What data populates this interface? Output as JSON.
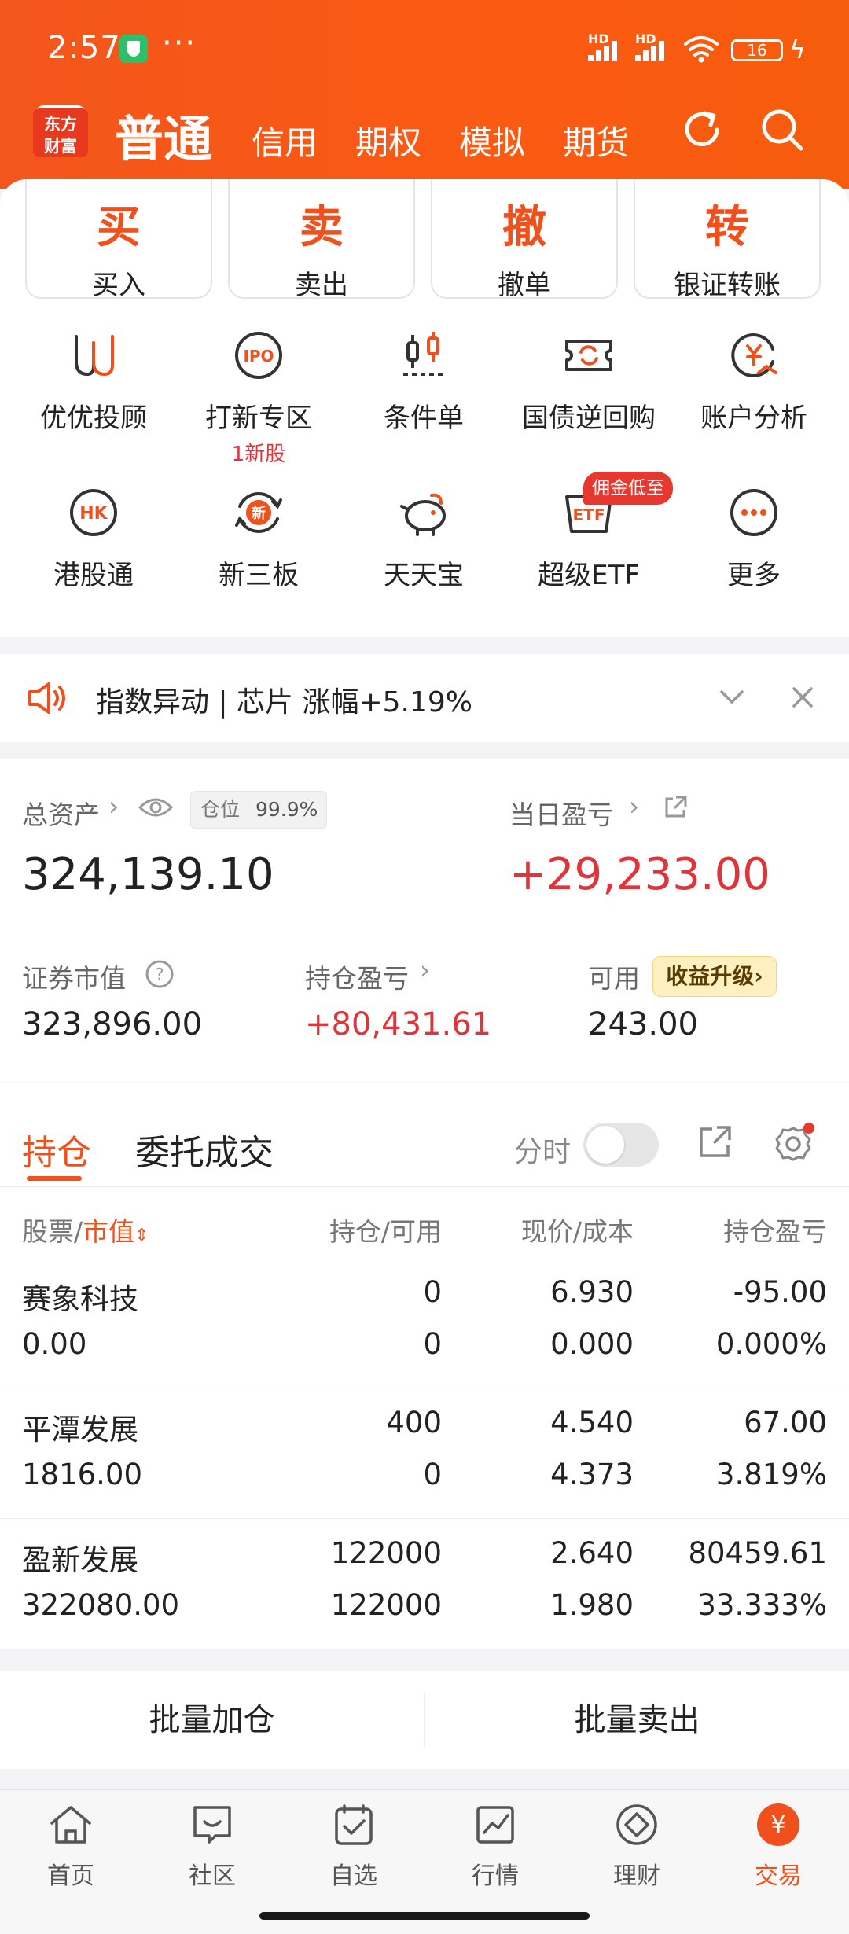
{
  "status_bar": {
    "time": "2:57",
    "dots": "···",
    "sig1": "HD",
    "sig2": "HD",
    "battery": "16",
    "colors": {
      "battery_fill": "#7ad35a",
      "shield": "#2fbf6a"
    }
  },
  "header": {
    "logo_top": "东方",
    "logo_bottom": "财富",
    "active_mode": "普通",
    "tabs": [
      "信用",
      "期权",
      "模拟",
      "期货"
    ],
    "icons": [
      "refresh-icon",
      "search-icon"
    ]
  },
  "quick_actions": [
    {
      "big": "买",
      "label": "买入"
    },
    {
      "big": "卖",
      "label": "卖出"
    },
    {
      "big": "撤",
      "label": "撤单"
    },
    {
      "big": "转",
      "label": "银证转账"
    }
  ],
  "grid": [
    {
      "label": "优优投顾",
      "icon": "uu-advisor-icon"
    },
    {
      "label": "打新专区",
      "icon": "ipo-icon",
      "sub": "1新股"
    },
    {
      "label": "条件单",
      "icon": "condition-order-icon"
    },
    {
      "label": "国债逆回购",
      "icon": "reverse-repo-icon"
    },
    {
      "label": "账户分析",
      "icon": "account-analysis-icon"
    },
    {
      "label": "港股通",
      "icon": "hk-connect-icon"
    },
    {
      "label": "新三板",
      "icon": "neeq-icon"
    },
    {
      "label": "天天宝",
      "icon": "piggy-bank-icon"
    },
    {
      "label": "超级ETF",
      "icon": "etf-icon",
      "badge": "佣金低至"
    },
    {
      "label": "更多",
      "icon": "more-icon"
    }
  ],
  "notice": {
    "text": "指数异动 | 芯片 涨幅+5.19%"
  },
  "assets": {
    "total_label": "总资产",
    "position_label": "仓位",
    "position_value": "99.9%",
    "total_value": "324,139.10",
    "daily_pl_label": "当日盈亏",
    "daily_pl_value": "+29,233.00",
    "market_value_label": "证券市值",
    "market_value": "323,896.00",
    "holding_pl_label": "持仓盈亏",
    "holding_pl_value": "+80,431.61",
    "available_label": "可用",
    "available_value": "243.00",
    "upgrade_label": "收益升级"
  },
  "holdings": {
    "tab_active": "持仓",
    "tab_other": "委托成交",
    "fenshi_label": "分时",
    "headers": {
      "stock": "股票",
      "market": "市值",
      "qty": "持仓/可用",
      "price": "现价/成本",
      "pl": "持仓盈亏"
    },
    "rows": [
      {
        "name": "赛象科技",
        "market_value": "0.00",
        "qty": "0",
        "avail": "0",
        "price": "6.930",
        "cost": "0.000",
        "pl": "-95.00",
        "pl_pct": "0.000%",
        "tone": "green"
      },
      {
        "name": "平潭发展",
        "market_value": "1816.00",
        "qty": "400",
        "avail": "0",
        "price": "4.540",
        "cost": "4.373",
        "pl": "67.00",
        "pl_pct": "3.819%",
        "tone": "red"
      },
      {
        "name": "盈新发展",
        "market_value": "322080.00",
        "qty": "122000",
        "avail": "122000",
        "price": "2.640",
        "cost": "1.980",
        "pl": "80459.61",
        "pl_pct": "33.333%",
        "tone": "red"
      }
    ]
  },
  "batch": {
    "add": "批量加仓",
    "sell": "批量卖出"
  },
  "bottom_nav": [
    {
      "label": "首页",
      "icon": "home-icon"
    },
    {
      "label": "社区",
      "icon": "community-icon"
    },
    {
      "label": "自选",
      "icon": "watchlist-icon"
    },
    {
      "label": "行情",
      "icon": "market-icon"
    },
    {
      "label": "理财",
      "icon": "wealth-icon"
    },
    {
      "label": "交易",
      "icon": "trade-icon",
      "active": true
    }
  ],
  "colors": {
    "brand_orange": "#f0511c",
    "up_red": "#e0343a",
    "down_green": "#13a03a"
  }
}
